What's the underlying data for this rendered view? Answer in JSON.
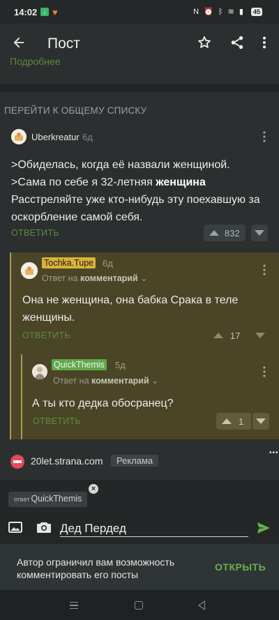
{
  "status_bar": {
    "time": "14:02",
    "battery": "45",
    "icons": [
      "download-icon",
      "heart-app-icon",
      "nfc-icon",
      "alarm-icon",
      "bluetooth-icon",
      "wifi-icon",
      "signal-icon",
      "battery-icon"
    ]
  },
  "header": {
    "title": "Пост",
    "icons": [
      "back-arrow-icon",
      "star-icon",
      "share-icon",
      "more-vert-icon"
    ]
  },
  "post_peek": {
    "text": "Подробнее"
  },
  "goto_all": "ПЕРЕЙТИ К ОБЩЕМУ СПИСКУ",
  "comments": [
    {
      "user": "Uberkreatur",
      "age": "6д",
      "lines": [
        ">Обиделась, когда её назвали женщиной.",
        ">Сама по себе я 32-летняя ",
        "женщина",
        "Расстреляйте уже кто-нибудь эту поехавшую за оскорбление самой себя."
      ],
      "reply_label": "ОТВЕТИТЬ",
      "votes": "832"
    },
    {
      "user": "Tochka.Tupe",
      "user_color": "#d8b23a",
      "age": "6д",
      "reply_to_prefix": "Ответ на ",
      "reply_to_target": "комментарий",
      "text": "Она не женщина, она бабка Срака в теле женщины.",
      "reply_label": "ОТВЕТИТЬ",
      "votes": "17"
    },
    {
      "user": "QuickThemis",
      "user_color": "#5fa84a",
      "age": "5д",
      "reply_to_prefix": "Ответ на ",
      "reply_to_target": "комментарий",
      "text": "А ты кто дедка обосранец?",
      "reply_label": "ОТВЕТИТЬ",
      "votes": "1"
    }
  ],
  "ad": {
    "site": "20let.strana.com",
    "badge": "Реклама"
  },
  "composer": {
    "chip_prefix": "ответ",
    "chip_user": "QuickThemis",
    "input_value": "Дед Пердед"
  },
  "restriction": {
    "message": "Автор ограничил вам возможность комментировать его посты",
    "action": "ОТКРЫТЬ"
  },
  "colors": {
    "background": "#2b2f2f",
    "thread": "#4a4527",
    "accent_green": "#6ab04c"
  }
}
